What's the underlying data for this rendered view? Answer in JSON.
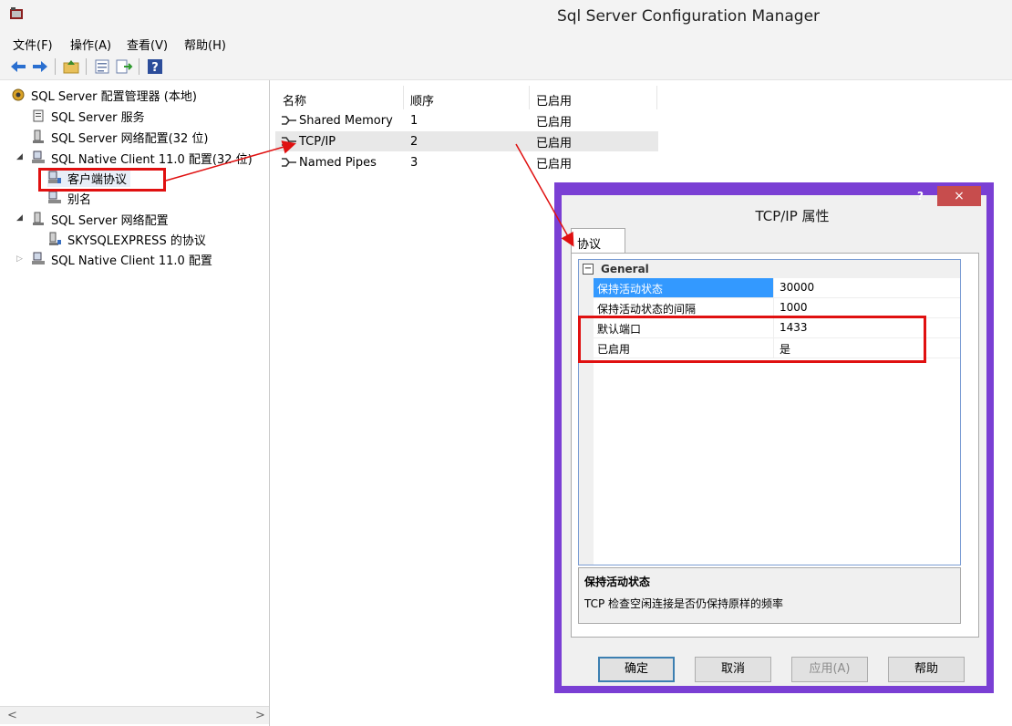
{
  "window": {
    "title": "Sql Server Configuration Manager"
  },
  "menu": [
    {
      "label": "文件(F)"
    },
    {
      "label": "操作(A)"
    },
    {
      "label": "查看(V)"
    },
    {
      "label": "帮助(H)"
    }
  ],
  "tree": {
    "items": [
      {
        "label": "SQL Server 配置管理器 (本地)",
        "icon": "config-manager-icon"
      },
      {
        "label": "SQL Server 服务",
        "icon": "services-icon"
      },
      {
        "label": "SQL Server 网络配置(32 位)",
        "icon": "network-icon"
      },
      {
        "label": "SQL Native Client 11.0 配置(32 位)",
        "icon": "client-icon"
      },
      {
        "label": "客户端协议",
        "icon": "protocol-icon"
      },
      {
        "label": "别名",
        "icon": "alias-icon"
      },
      {
        "label": "SQL Server 网络配置",
        "icon": "network-icon"
      },
      {
        "label": "SKYSQLEXPRESS 的协议",
        "icon": "protocol-icon"
      },
      {
        "label": "SQL Native Client 11.0 配置",
        "icon": "client-icon"
      }
    ]
  },
  "list": {
    "columns": [
      "名称",
      "顺序",
      "已启用"
    ],
    "rows": [
      {
        "name": "Shared Memory",
        "order": "1",
        "enabled": "已启用"
      },
      {
        "name": "TCP/IP",
        "order": "2",
        "enabled": "已启用"
      },
      {
        "name": "Named Pipes",
        "order": "3",
        "enabled": "已启用"
      }
    ]
  },
  "dialog": {
    "title": "TCP/IP 属性",
    "help_glyph": "?",
    "close_glyph": "×",
    "tab": "协议",
    "category": "General",
    "category_toggle": "⊟",
    "properties": [
      {
        "name": "保持活动状态",
        "value": "30000",
        "selected": true
      },
      {
        "name": "保持活动状态的间隔",
        "value": "1000"
      },
      {
        "name": "默认端口",
        "value": "1433"
      },
      {
        "name": "已启用",
        "value": "是"
      }
    ],
    "description": {
      "title": "保持活动状态",
      "text": "TCP 检查空闲连接是否仍保持原样的频率"
    },
    "buttons": {
      "ok": "确定",
      "cancel": "取消",
      "apply": "应用(A)",
      "help": "帮助"
    }
  },
  "colors": {
    "dialog_frame": "#7a3fd4",
    "annotation": "#e01010",
    "selection": "#3399ff"
  }
}
